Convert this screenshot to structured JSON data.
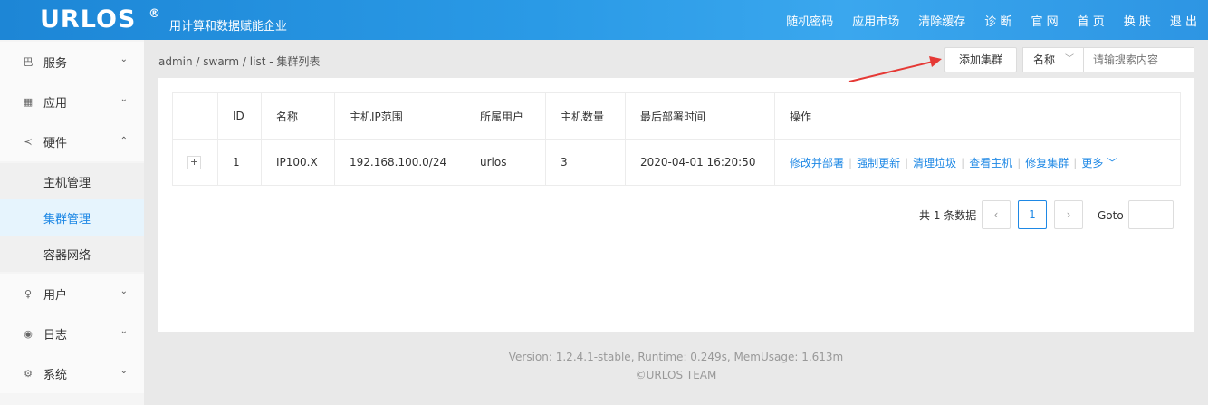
{
  "header": {
    "logo": "URLOS",
    "logo_mark": "®",
    "slogan": "用计算和数据赋能企业",
    "nav": [
      "随机密码",
      "应用市场",
      "清除缓存",
      "诊 断",
      "官 网",
      "首 页",
      "换 肤",
      "退 出"
    ]
  },
  "sidebar": {
    "items": [
      {
        "label": "服务",
        "icon": "services-icon",
        "glyph": "巴",
        "chevron": "⌄"
      },
      {
        "label": "应用",
        "icon": "apps-grid-icon",
        "glyph": "▦",
        "chevron": "⌄"
      },
      {
        "label": "硬件",
        "icon": "share-icon",
        "glyph": "≺",
        "chevron": "⌃"
      },
      {
        "label": "用户",
        "icon": "user-icon",
        "glyph": "♀",
        "chevron": "⌄"
      },
      {
        "label": "日志",
        "icon": "eye-icon",
        "glyph": "◉",
        "chevron": "⌄"
      },
      {
        "label": "系统",
        "icon": "gear-icon",
        "glyph": "⚙",
        "chevron": "⌄"
      }
    ],
    "subitems": [
      "主机管理",
      "集群管理",
      "容器网络"
    ]
  },
  "breadcrumb": "admin  /  swarm  /  list  -  集群列表",
  "toolbar": {
    "add_label": "添加集群",
    "select_value": "名称",
    "search_placeholder": "请输搜索内容"
  },
  "table": {
    "headers": [
      "",
      "ID",
      "名称",
      "主机IP范围",
      "所属用户",
      "主机数量",
      "最后部署时间",
      "操作"
    ],
    "row": {
      "expand": "+",
      "id": "1",
      "name": "IP100.X",
      "ip_range": "192.168.100.0/24",
      "user": "urlos",
      "host_count": "3",
      "deploy_time": "2020-04-01 16:20:50"
    },
    "ops": [
      "修改并部署",
      "强制更新",
      "清理垃圾",
      "查看主机",
      "修复集群",
      "更多"
    ]
  },
  "pagination": {
    "total": "共 1 条数据",
    "prev": "‹",
    "page": "1",
    "next": "›",
    "goto": "Goto"
  },
  "footer": {
    "line1": "Version: 1.2.4.1-stable,   Runtime: 0.249s,   MemUsage: 1.613m",
    "line2": "©URLOS TEAM"
  },
  "colors": {
    "header": "#2a9ae6",
    "accent": "#1e88e5",
    "arrow": "#e53935"
  }
}
